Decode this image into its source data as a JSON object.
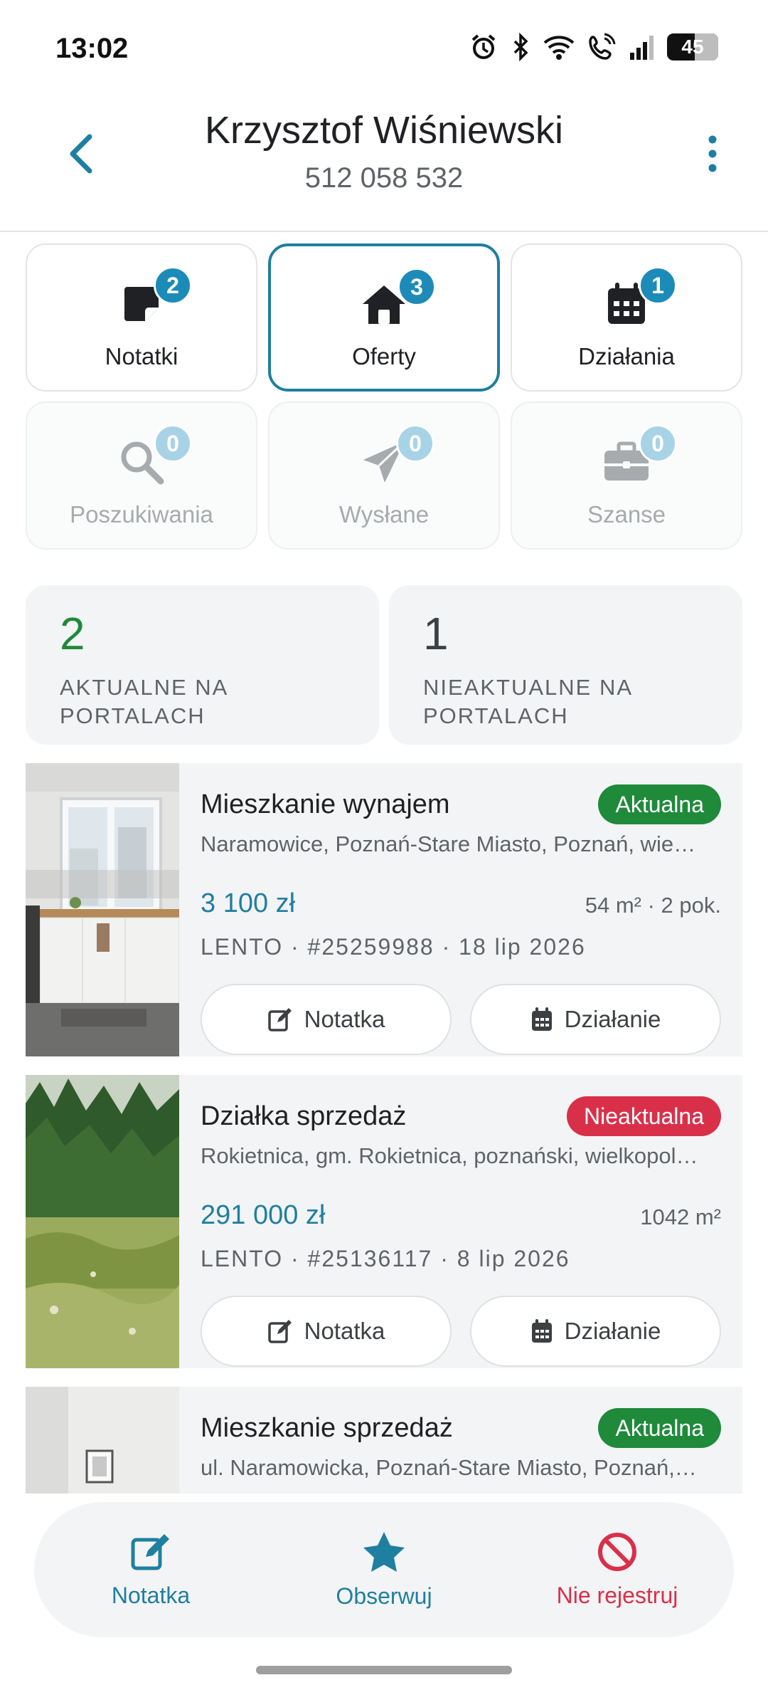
{
  "status_bar": {
    "time": "13:02",
    "battery": "45"
  },
  "header": {
    "name": "Krzysztof Wiśniewski",
    "phone": "512 058 532"
  },
  "tiles": [
    {
      "label": "Notatki",
      "count": "2",
      "icon": "note-icon",
      "state": "enabled"
    },
    {
      "label": "Oferty",
      "count": "3",
      "icon": "house-icon",
      "state": "active"
    },
    {
      "label": "Działania",
      "count": "1",
      "icon": "calendar-icon",
      "state": "enabled"
    },
    {
      "label": "Poszukiwania",
      "count": "0",
      "icon": "search-icon",
      "state": "disabled"
    },
    {
      "label": "Wysłane",
      "count": "0",
      "icon": "paper-plane-icon",
      "state": "disabled"
    },
    {
      "label": "Szanse",
      "count": "0",
      "icon": "briefcase-icon",
      "state": "disabled"
    }
  ],
  "stats": [
    {
      "value": "2",
      "label": "AKTUALNE NA PORTALACH"
    },
    {
      "value": "1",
      "label": "NIEAKTUALNE NA PORTALACH"
    }
  ],
  "listings": [
    {
      "title": "Mieszkanie wynajem",
      "status": "Aktualna",
      "address": "Naramowice, Poznań-Stare Miasto, Poznań, wie…",
      "price": "3 100 zł",
      "meta": "54 m² · 2 pok.",
      "ref": "LENTO · #25259988 · 18 lip 2026",
      "note_button": "Notatka",
      "action_button": "Działanie"
    },
    {
      "title": "Działka sprzedaż",
      "status": "Nieaktualna",
      "address": "Rokietnica, gm. Rokietnica, poznański, wielkopol…",
      "price": "291 000 zł",
      "meta": "1042 m²",
      "ref": "LENTO · #25136117 · 8 lip 2026",
      "note_button": "Notatka",
      "action_button": "Działanie"
    },
    {
      "title": "Mieszkanie sprzedaż",
      "status": "Aktualna",
      "address": "ul. Naramowicka, Poznań-Stare Miasto, Poznań,…"
    }
  ],
  "bottom_bar": {
    "note": "Notatka",
    "observe": "Obserwuj",
    "no_register": "Nie rejestruj"
  },
  "colors": {
    "accent": "#1f7fa0",
    "badge": "#1c8bb8",
    "active_status": "#1e8a3a",
    "inactive_status": "#d9304a"
  }
}
